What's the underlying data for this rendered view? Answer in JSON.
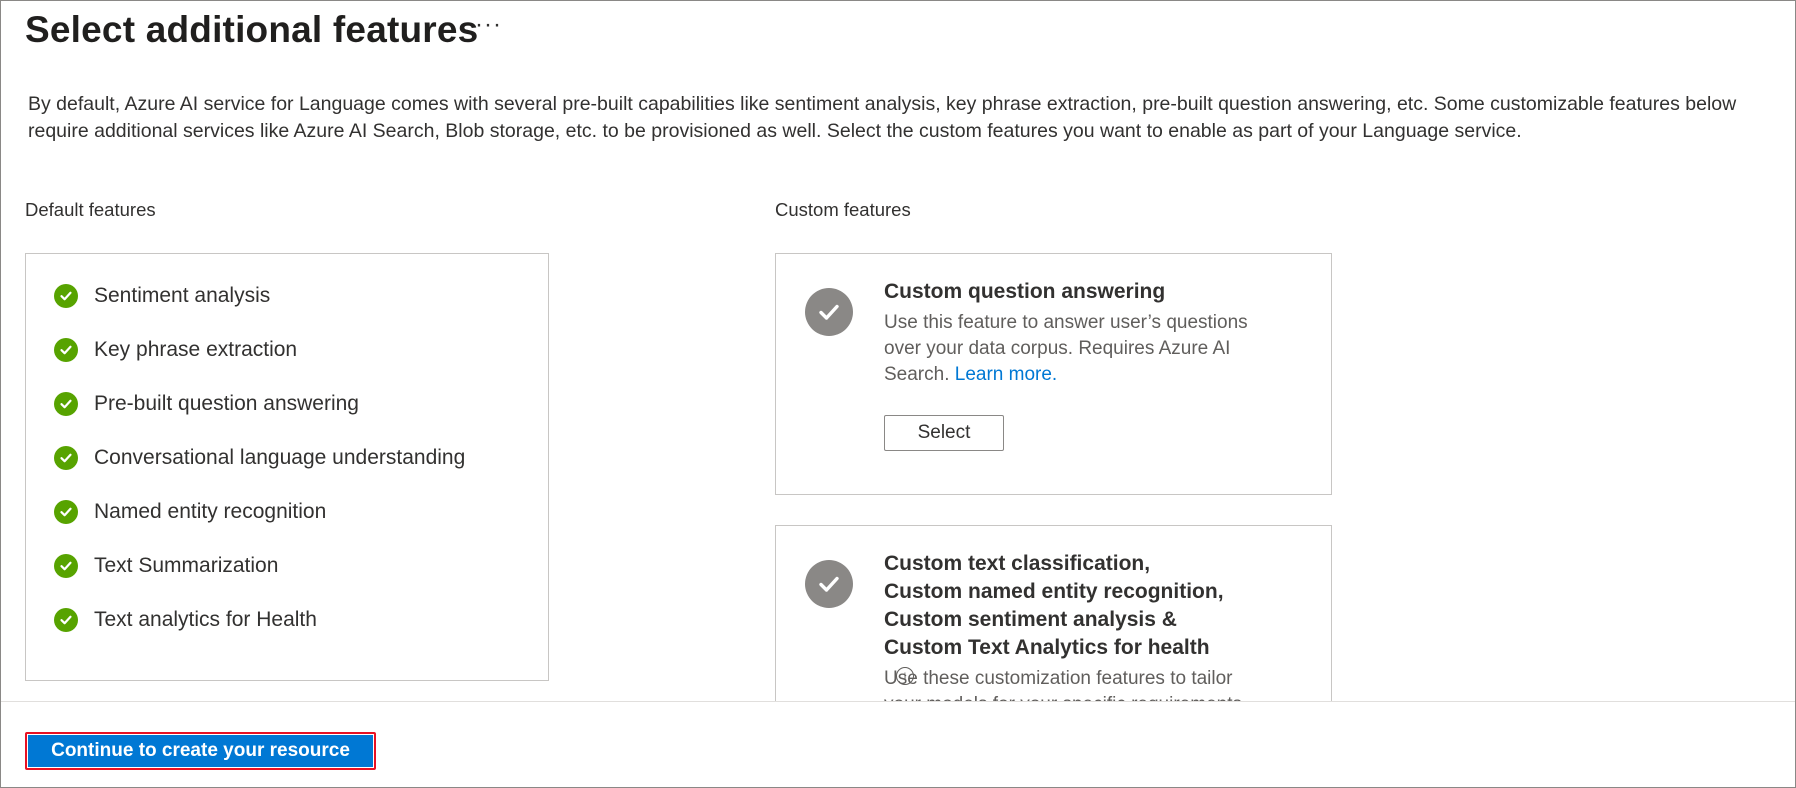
{
  "header": {
    "title": "Select additional features",
    "more_label": "···"
  },
  "description": "By default, Azure AI service for Language comes with several pre-built capabilities like sentiment analysis, key phrase extraction, pre-built question answering, etc. Some customizable features below require additional services like Azure AI Search, Blob storage, etc. to be provisioned as well. Select the custom features you want to enable as part of your Language service.",
  "default_features": {
    "label": "Default features",
    "items": [
      "Sentiment analysis",
      "Key phrase extraction",
      "Pre-built question answering",
      "Conversational language understanding",
      "Named entity recognition",
      "Text Summarization",
      "Text analytics for Health"
    ]
  },
  "custom_features": {
    "label": "Custom features",
    "cards": [
      {
        "title": "Custom question answering",
        "text": "Use this feature to answer user’s questions over your data corpus. Requires Azure AI Search.",
        "link": "Learn more.",
        "button": "Select"
      },
      {
        "title": "Custom text classification, Custom named entity recognition, Custom sentiment analysis & Custom Text Analytics for health",
        "text": "Use these customization features to tailor your models for your specific requirements"
      }
    ]
  },
  "footer": {
    "primary_button": "Continue to create your resource"
  },
  "colors": {
    "accent": "#0078d4",
    "check_green": "#57a300",
    "check_gray": "#8a8886",
    "highlight_border": "#e81123"
  },
  "icons": [
    "more-icon",
    "check-circle-icon",
    "info-icon"
  ]
}
